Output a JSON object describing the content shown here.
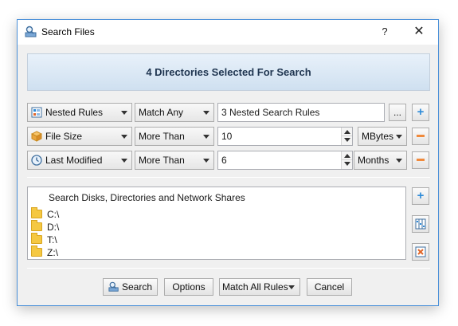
{
  "window": {
    "title": "Search Files",
    "help_glyph": "?",
    "close_glyph": "✕"
  },
  "banner": {
    "text": "4 Directories Selected For Search"
  },
  "rules": [
    {
      "type": "Nested Rules",
      "type_icon": "nested-rules-icon",
      "condition": "Match Any",
      "value": "3 Nested Search Rules",
      "unit": "",
      "action": "add"
    },
    {
      "type": "File Size",
      "type_icon": "file-size-icon",
      "condition": "More Than",
      "value": "10",
      "unit": "MBytes",
      "action": "remove"
    },
    {
      "type": "Last Modified",
      "type_icon": "clock-icon",
      "condition": "More Than",
      "value": "6",
      "unit": "Months",
      "action": "remove"
    }
  ],
  "browse_label": "...",
  "dirs": {
    "header": "Search Disks, Directories and Network Shares",
    "items": [
      "C:\\",
      "D:\\",
      "T:\\",
      "Z:\\"
    ]
  },
  "footer": {
    "search_label": "Search",
    "options_label": "Options",
    "match_label": "Match All Rules",
    "cancel_label": "Cancel"
  },
  "colors": {
    "accent": "#2e8bd8",
    "remove": "#f08a3c",
    "banner_text": "#1f3550"
  }
}
